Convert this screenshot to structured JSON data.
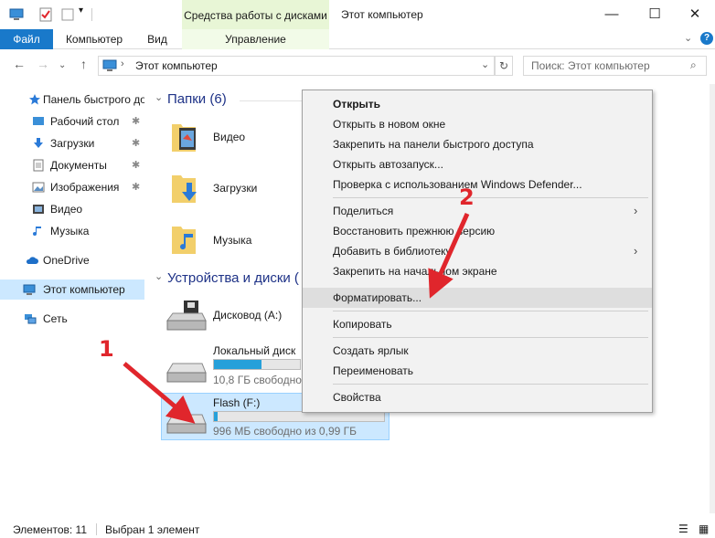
{
  "window": {
    "title": "Этот компьютер",
    "tools_tab": "Средства работы с дисками"
  },
  "ribbon": {
    "file": "Файл",
    "computer": "Компьютер",
    "view": "Вид",
    "manage": "Управление"
  },
  "address": {
    "path": "Этот компьютер",
    "search_placeholder": "Поиск: Этот компьютер"
  },
  "sidebar": {
    "items": [
      {
        "label": "Панель быстрого доступа",
        "icon": "star-icon"
      },
      {
        "label": "Рабочий стол",
        "icon": "desktop-icon"
      },
      {
        "label": "Загрузки",
        "icon": "download-icon"
      },
      {
        "label": "Документы",
        "icon": "document-icon"
      },
      {
        "label": "Изображения",
        "icon": "image-icon"
      },
      {
        "label": "Видео",
        "icon": "video-icon"
      },
      {
        "label": "Музыка",
        "icon": "music-icon"
      },
      {
        "label": "OneDrive",
        "icon": "cloud-icon"
      },
      {
        "label": "Этот компьютер",
        "icon": "computer-icon"
      },
      {
        "label": "Сеть",
        "icon": "network-icon"
      }
    ]
  },
  "content": {
    "folders_header": "Папки (6)",
    "folders": [
      {
        "name": "Видео"
      },
      {
        "name": "Загрузки"
      },
      {
        "name": "Музыка"
      }
    ],
    "devices_header": "Устройства и диски (",
    "drives": [
      {
        "name": "Дисковод (A:)"
      },
      {
        "name": "Локальный диск",
        "free": "10,8 ГБ свободно",
        "used_fraction": 0.55
      },
      {
        "name": "Flash (F:)",
        "free": "996 МБ свободно из 0,99 ГБ",
        "used_fraction": 0.02
      }
    ]
  },
  "context_menu": {
    "items": [
      {
        "label": "Открыть",
        "bold": true
      },
      {
        "label": "Открыть в новом окне"
      },
      {
        "label": "Закрепить на панели быстрого доступа"
      },
      {
        "label": "Открыть автозапуск..."
      },
      {
        "label": "Проверка с использованием Windows Defender..."
      },
      {
        "label": "Поделиться"
      },
      {
        "label": "Восстановить прежнюю версию"
      },
      {
        "label": "Добавить в библиотеку"
      },
      {
        "label": "Закрепить на начальном экране"
      },
      {
        "label": "Форматировать..."
      },
      {
        "label": "Копировать"
      },
      {
        "label": "Создать ярлык"
      },
      {
        "label": "Переименовать"
      },
      {
        "label": "Свойства"
      }
    ]
  },
  "status": {
    "items": "Элементов: 11",
    "selected": "Выбран 1 элемент"
  },
  "annotations": {
    "step1": "1",
    "step2": "2",
    "color": "#e0262c"
  },
  "colors": {
    "accent": "#1979ca",
    "selection": "#cce8ff",
    "tools_tab": "#e8f6d6"
  }
}
